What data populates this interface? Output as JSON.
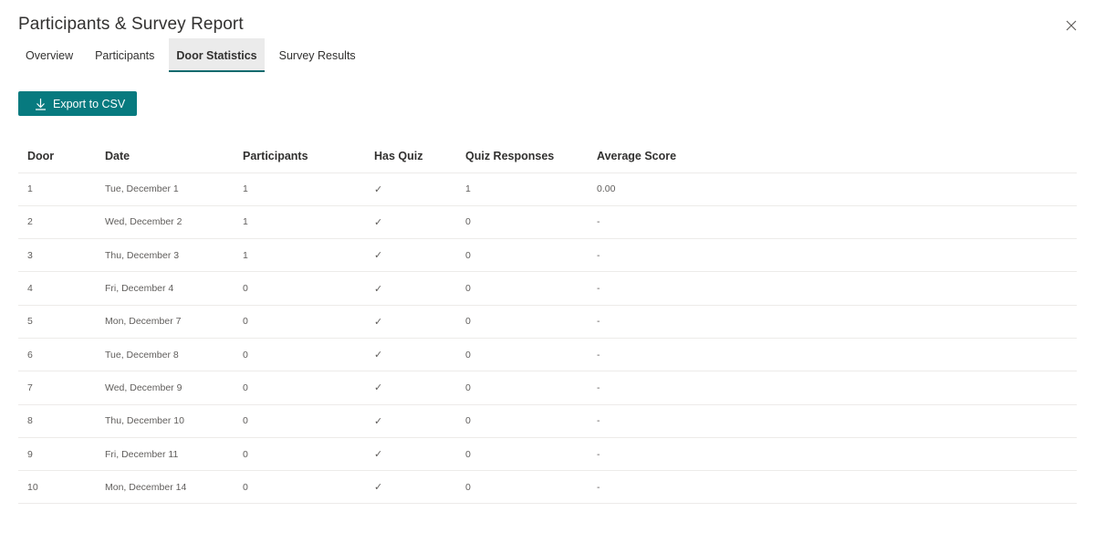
{
  "dialog": {
    "title": "Participants & Survey Report",
    "close_icon": "close-icon"
  },
  "tabs": [
    {
      "label": "Overview",
      "active": false
    },
    {
      "label": "Participants",
      "active": false
    },
    {
      "label": "Door Statistics",
      "active": true
    },
    {
      "label": "Survey Results",
      "active": false
    }
  ],
  "toolbar": {
    "export_label": "Export to CSV",
    "export_icon": "download-icon",
    "accent_color": "#077a7f"
  },
  "table": {
    "headers": [
      "Door",
      "Date",
      "Participants",
      "Has Quiz",
      "Quiz Responses",
      "Average Score"
    ],
    "rows": [
      {
        "door": "1",
        "date": "Tue, December 1",
        "participants": "1",
        "has_quiz": "✓",
        "quiz_responses": "1",
        "average_score": "0.00"
      },
      {
        "door": "2",
        "date": "Wed, December 2",
        "participants": "1",
        "has_quiz": "✓",
        "quiz_responses": "0",
        "average_score": "-"
      },
      {
        "door": "3",
        "date": "Thu, December 3",
        "participants": "1",
        "has_quiz": "✓",
        "quiz_responses": "0",
        "average_score": "-"
      },
      {
        "door": "4",
        "date": "Fri, December 4",
        "participants": "0",
        "has_quiz": "✓",
        "quiz_responses": "0",
        "average_score": "-"
      },
      {
        "door": "5",
        "date": "Mon, December 7",
        "participants": "0",
        "has_quiz": "✓",
        "quiz_responses": "0",
        "average_score": "-"
      },
      {
        "door": "6",
        "date": "Tue, December 8",
        "participants": "0",
        "has_quiz": "✓",
        "quiz_responses": "0",
        "average_score": "-"
      },
      {
        "door": "7",
        "date": "Wed, December 9",
        "participants": "0",
        "has_quiz": "✓",
        "quiz_responses": "0",
        "average_score": "-"
      },
      {
        "door": "8",
        "date": "Thu, December 10",
        "participants": "0",
        "has_quiz": "✓",
        "quiz_responses": "0",
        "average_score": "-"
      },
      {
        "door": "9",
        "date": "Fri, December 11",
        "participants": "0",
        "has_quiz": "✓",
        "quiz_responses": "0",
        "average_score": "-"
      },
      {
        "door": "10",
        "date": "Mon, December 14",
        "participants": "0",
        "has_quiz": "✓",
        "quiz_responses": "0",
        "average_score": "-"
      }
    ]
  }
}
